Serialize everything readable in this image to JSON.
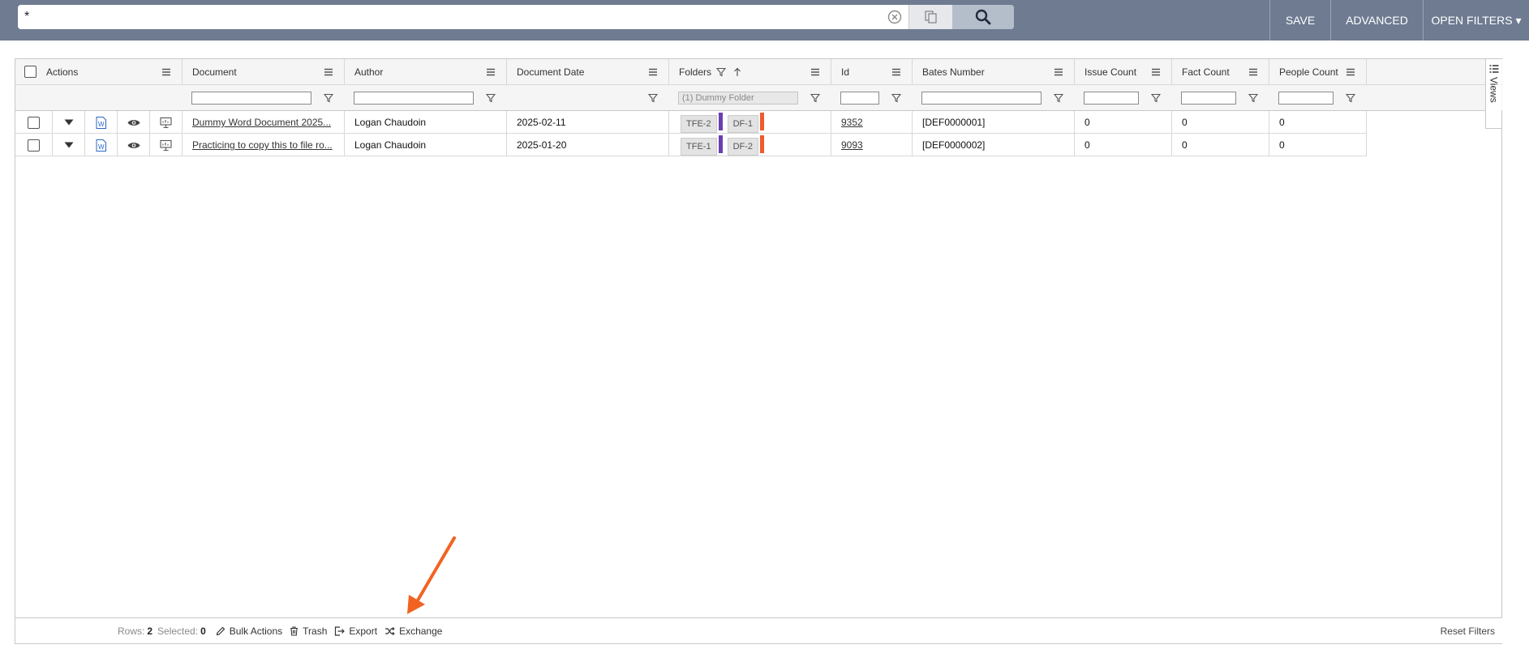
{
  "search": {
    "value": "*"
  },
  "top_buttons": {
    "save": "SAVE",
    "advanced": "ADVANCED",
    "open_filters": "OPEN FILTERS ▾"
  },
  "columns": {
    "actions": "Actions",
    "document": "Document",
    "author": "Author",
    "document_date": "Document Date",
    "folders": "Folders",
    "id": "Id",
    "bates_number": "Bates Number",
    "issue_count": "Issue Count",
    "fact_count": "Fact Count",
    "people_count": "People Count"
  },
  "filters": {
    "folders_value": "(1) Dummy Folder"
  },
  "rows": [
    {
      "document": "Dummy Word Document 2025...",
      "author": "Logan Chaudoin",
      "date": "2025-02-11",
      "tags": [
        "TFE-2",
        "DF-1"
      ],
      "tag_colors": [
        "#6a3fb0",
        "#ef5a2e"
      ],
      "id": "9352",
      "bates": "[DEF0000001]",
      "issue": "0",
      "fact": "0",
      "people": "0"
    },
    {
      "document": "Practicing to copy this to file ro...",
      "author": "Logan Chaudoin",
      "date": "2025-01-20",
      "tags": [
        "TFE-1",
        "DF-2"
      ],
      "tag_colors": [
        "#6a3fb0",
        "#ef5a2e"
      ],
      "id": "9093",
      "bates": "[DEF0000002]",
      "issue": "0",
      "fact": "0",
      "people": "0"
    }
  ],
  "side": {
    "views": "Views"
  },
  "footer": {
    "rows_label": "Rows:",
    "rows_value": "2",
    "selected_label": "Selected:",
    "selected_value": "0",
    "bulk_actions": "Bulk Actions",
    "trash": "Trash",
    "export": "Export",
    "exchange": "Exchange",
    "reset_filters": "Reset Filters"
  },
  "colors": {
    "topbar": "#6e7b91",
    "arrow": "#f26322",
    "link": "#333333"
  }
}
